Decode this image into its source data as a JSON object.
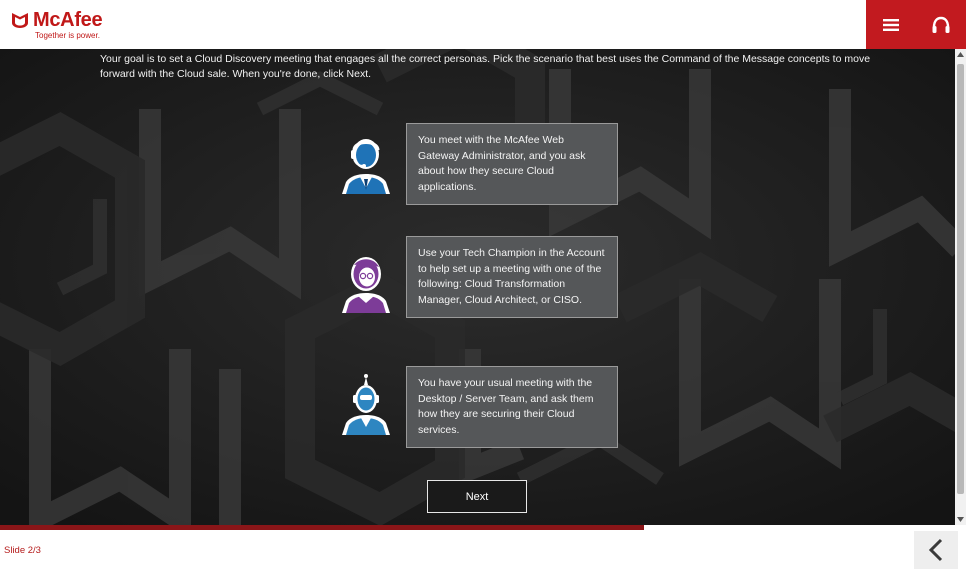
{
  "brand": {
    "name": "McAfee",
    "tagline": "Together is power.",
    "color": "#c01818"
  },
  "header": {
    "menu_icon": "hamburger-menu-icon",
    "support_icon": "headphones-icon",
    "accent": "#c21a1f"
  },
  "slide": {
    "instructions": "Your goal is to set a Cloud Discovery meeting that engages all the correct personas. Pick the scenario that best uses the Command of the Message concepts to move forward with the Cloud sale. When you're done, click Next.",
    "options": [
      {
        "avatar_icon": "headset-agent-avatar-icon",
        "text": "You meet with the McAfee Web Gateway Administrator, and you ask about how they secure Cloud applications."
      },
      {
        "avatar_icon": "female-champion-avatar-icon",
        "text": "Use your Tech Champion in the Account to help set up a meeting with one of the following: Cloud Transformation Manager, Cloud Architect, or CISO."
      },
      {
        "avatar_icon": "robot-operator-avatar-icon",
        "text": "You have your usual meeting with the Desktop / Server Team, and ask them how they are securing their Cloud services."
      }
    ],
    "next_label": "Next"
  },
  "footer": {
    "slide_counter": "Slide 2/3",
    "back_icon": "chevron-left-icon",
    "progress_fraction": 0.667
  }
}
